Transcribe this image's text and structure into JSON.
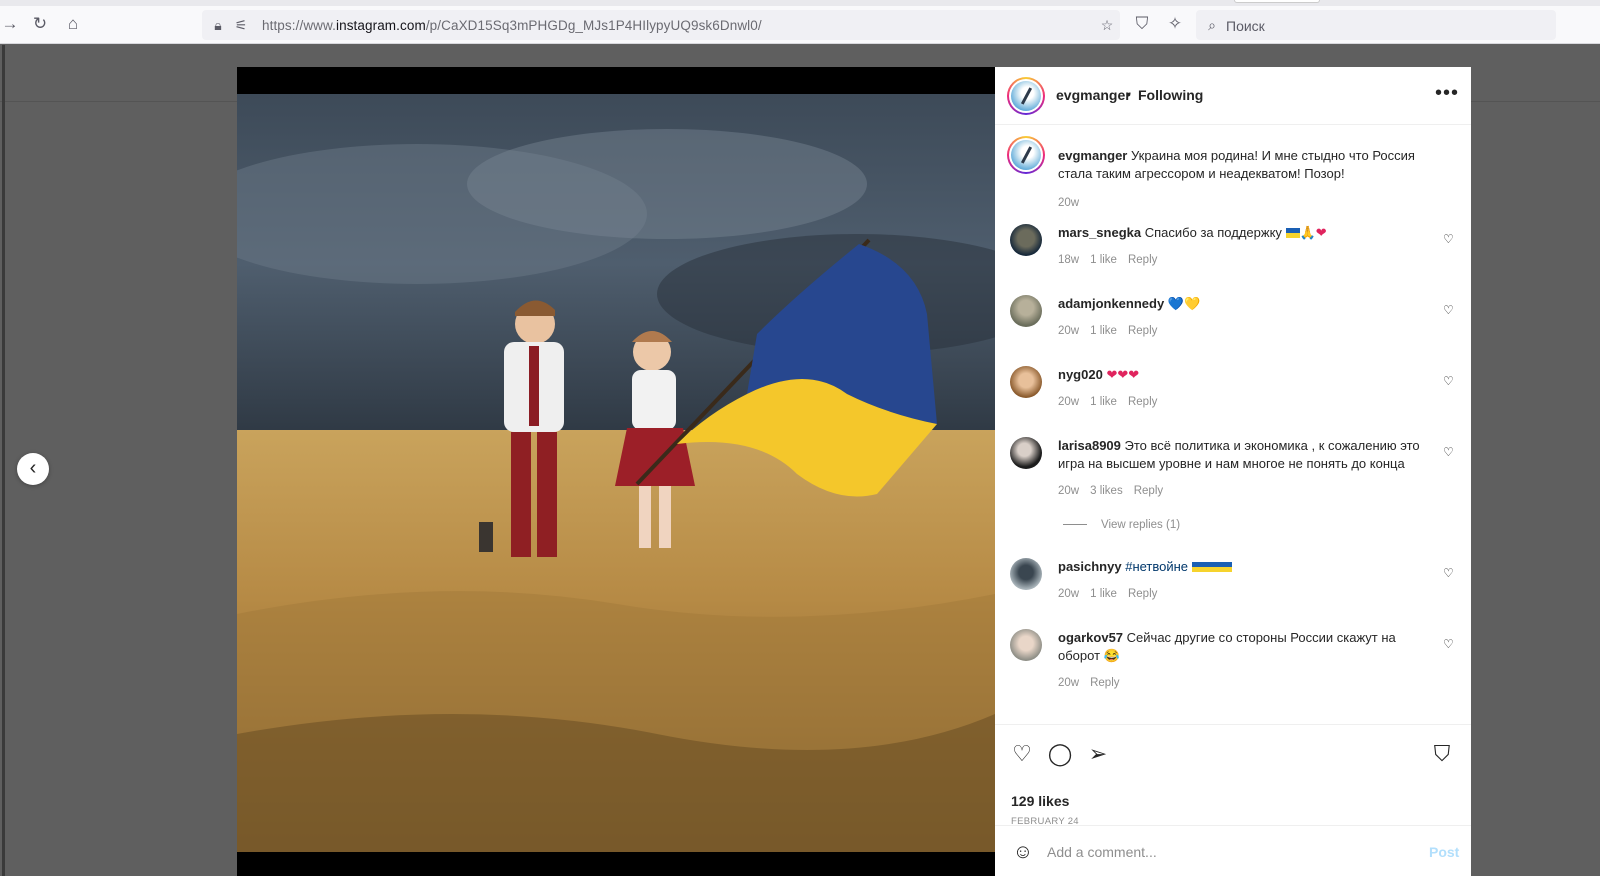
{
  "browser": {
    "url_prefix": "https://www.",
    "url_host": "instagram.com",
    "url_path": "/p/CaXD15Sq3mPHGDg_MJs1P4HIlypyUQ9sk6Dnwl0/",
    "search_placeholder": "Поиск"
  },
  "post": {
    "username": "evgmanger",
    "follow_status": "Following",
    "caption": "Украина моя родина! И мне стыдно что Россия стала таким агрессором и неадекватом! Позор!",
    "caption_time": "20w",
    "likes": "129 likes",
    "date": "FEBRUARY 24"
  },
  "comments": [
    {
      "user": "mars_snegka",
      "text": "Спасибо за поддержку",
      "time": "18w",
      "likes": "1 like",
      "reply": "Reply"
    },
    {
      "user": "adamjonkennedy",
      "text": "💙💛",
      "time": "20w",
      "likes": "1 like",
      "reply": "Reply"
    },
    {
      "user": "nyg020",
      "text": "❤❤❤",
      "time": "20w",
      "likes": "1 like",
      "reply": "Reply"
    },
    {
      "user": "larisa8909",
      "text": "Это всё политика и экономика , к сожалению это игра на высшем уровне и нам многое не понять до конца",
      "time": "20w",
      "likes": "3 likes",
      "reply": "Reply",
      "view_replies": "View replies (1)"
    },
    {
      "user": "pasichnyy",
      "text": "#нетвойне",
      "time": "20w",
      "likes": "1 like",
      "reply": "Reply"
    },
    {
      "user": "ogarkov57",
      "text": "Сейчас другие со стороны России скажут на оборот 😂",
      "time": "20w",
      "reply": "Reply"
    }
  ],
  "add_comment": {
    "placeholder": "Add a comment...",
    "post_label": "Post"
  },
  "icons": {
    "back": "arrow-left-icon",
    "reload": "reload-icon",
    "home": "home-icon",
    "lock": "lock-icon",
    "permissions": "permissions-icon",
    "bookmark_star": "star-icon",
    "shield": "shield-icon",
    "extensions": "sparkle-icon",
    "search": "search-icon",
    "prev": "chevron-left-icon",
    "heart": "heart-icon",
    "comment": "comment-icon",
    "share": "send-icon",
    "save": "bookmark-icon",
    "emoji": "emoji-icon",
    "more": "more-icon"
  }
}
